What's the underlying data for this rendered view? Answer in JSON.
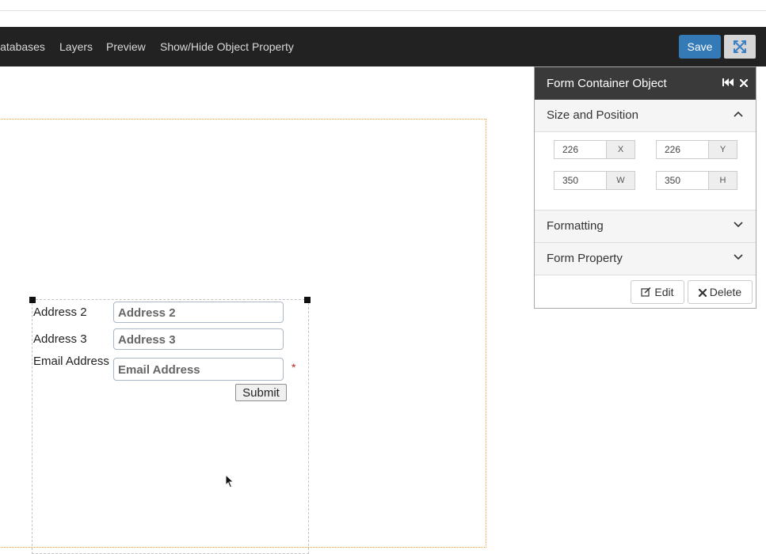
{
  "toolbar": {
    "nav": [
      "Databases",
      "Layers",
      "Preview",
      "Show/Hide Object Property"
    ],
    "save_label": "Save"
  },
  "form": {
    "fields": [
      {
        "label": "Address 2",
        "placeholder": "Address 2",
        "required": false
      },
      {
        "label": "Address 3",
        "placeholder": "Address 3",
        "required": false
      },
      {
        "label": "Email Address",
        "placeholder": "Email Address",
        "required": true
      }
    ],
    "required_mark": "*",
    "submit_label": "Submit"
  },
  "panel": {
    "title": "Form Container Object",
    "sections": {
      "size_position": "Size and Position",
      "formatting": "Formatting",
      "form_property": "Form Property"
    },
    "size_position_expanded": true,
    "x": {
      "value": "226",
      "addon": "X"
    },
    "y": {
      "value": "226",
      "addon": "Y"
    },
    "w": {
      "value": "350",
      "addon": "W"
    },
    "h": {
      "value": "350",
      "addon": "H"
    },
    "edit_label": "Edit",
    "delete_label": "Delete"
  },
  "icons": {
    "fullscreen": "fullscreen-icon",
    "collapse_panel": "skip-back-icon",
    "close_panel": "close-icon",
    "edit": "edit-icon",
    "delete": "delete-icon"
  },
  "colors": {
    "toolbar_bg": "#222222",
    "save_blue": "#337ab7",
    "panel_header": "#3a3a3a",
    "canvas_border": "#f0a22b",
    "required_red": "#cc2222"
  }
}
